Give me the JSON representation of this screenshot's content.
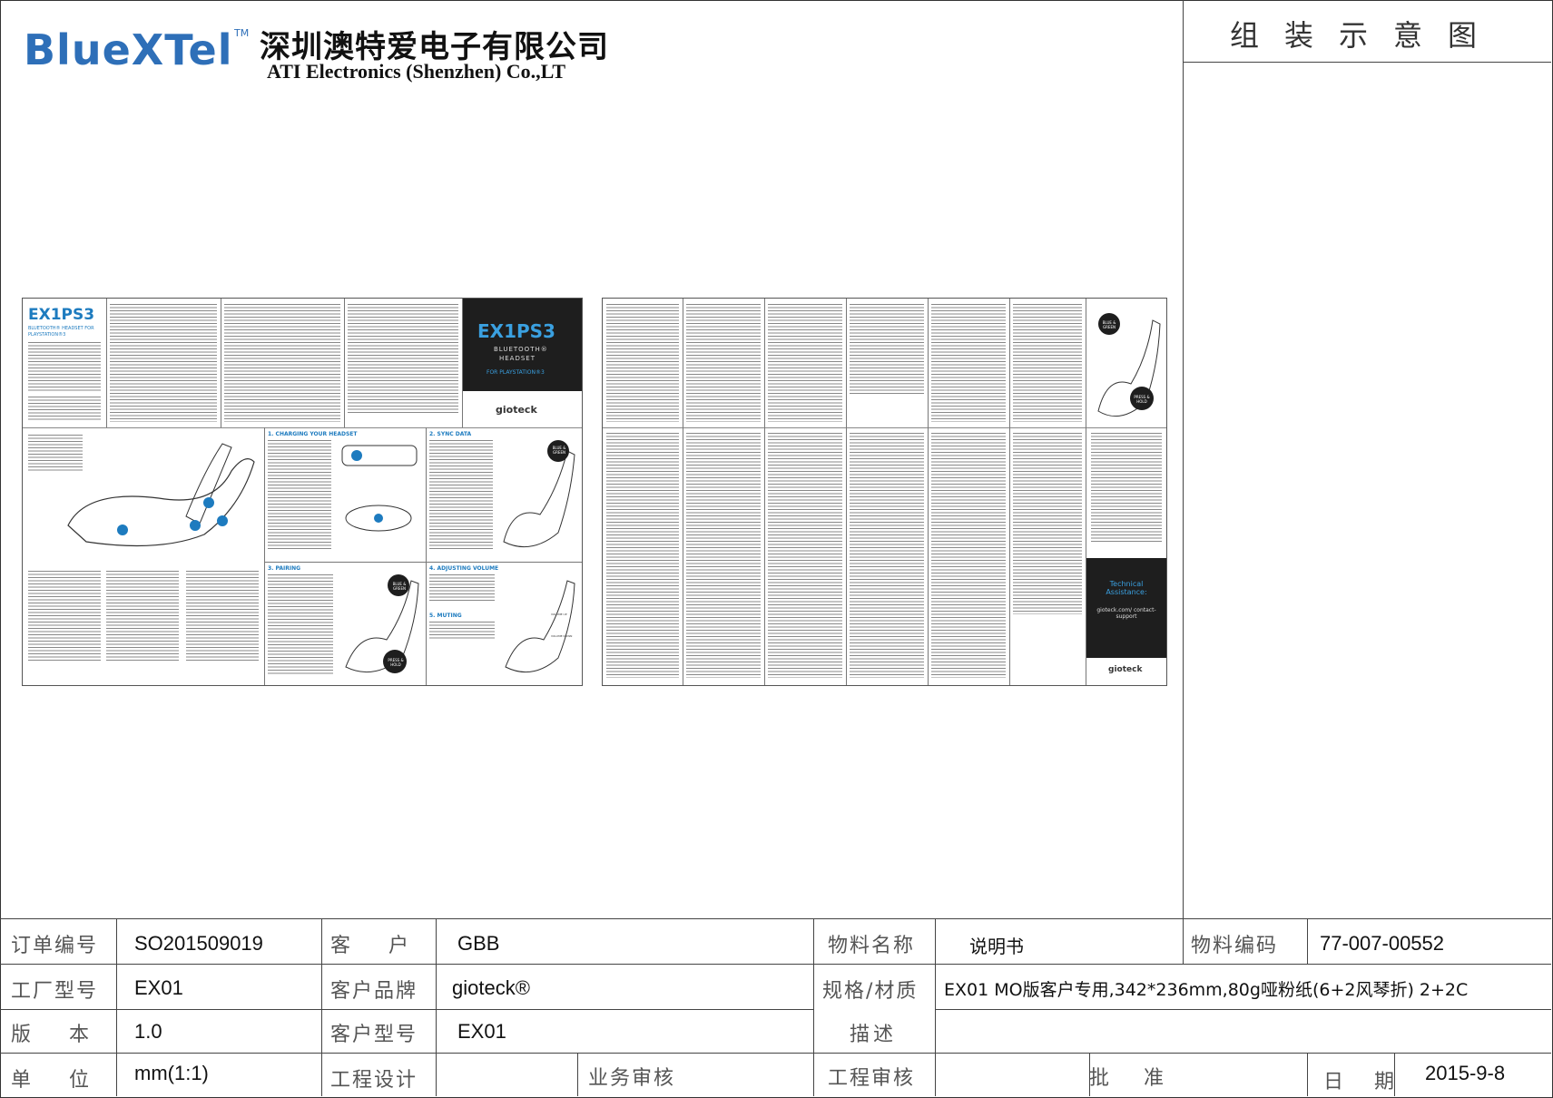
{
  "header": {
    "logo": "BlueXTel",
    "logo_tm": "TM",
    "company_cn": "深圳澳特爱电子有限公司",
    "company_en": "ATI Electronics (Shenzhen) Co.,LT",
    "drawing_title": "组装示意图"
  },
  "leaflet_left": {
    "model": "EX1PS3",
    "subtitle": "BLUETOOTH® HEADSET FOR PLAYSTATION®3",
    "cover_model": "EX1PS3",
    "cover_sub1": "BLUETOOTH®",
    "cover_sub2": "HEADSET",
    "cover_sub3": "FOR PLAYSTATION®3",
    "cover_brand": "gioteck",
    "sec1": "1. CHARGING YOUR HEADSET",
    "sec2": "2. SYNC DATA",
    "sec3": "3. PAIRING",
    "sec4": "4. ADJUSTING VOLUME",
    "sec5": "5. MUTING",
    "blue_green": "BLUE & GREEN",
    "press_hold": "PRESS & HOLD",
    "volume_up": "VOLUME UP",
    "volume_down": "VOLUME DOWN"
  },
  "leaflet_right": {
    "tech_title": "Technical Assistance:",
    "tech_url": "gioteck.com/ contact-support",
    "brand": "gioteck",
    "blue_green": "BLUE & GREEN",
    "press_hold": "PRESS & HOLD"
  },
  "table": {
    "order_no_label": "订单编号",
    "order_no": "SO201509019",
    "customer_label": "客　户",
    "customer": "GBB",
    "material_name_label": "物料名称",
    "material_name": "说明书",
    "material_code_label": "物料编码",
    "material_code": "77-007-00552",
    "factory_model_label": "工厂型号",
    "factory_model": "EX01",
    "customer_brand_label": "客户品牌",
    "customer_brand": "gioteck®",
    "spec_label_1": "规格/材质",
    "spec_label_2": "描述",
    "spec": "EX01 MO版客户专用,342*236mm,80g哑粉纸(6+2风琴折) 2+2C",
    "version_label": "版　本",
    "version": "1.0",
    "customer_model_label": "客户型号",
    "customer_model": "EX01",
    "unit_label": "单　位",
    "unit": "mm(1:1)",
    "eng_design_label": "工程设计",
    "biz_review_label": "业务审核",
    "eng_review_label": "工程审核",
    "approve_label": "批　准",
    "date_label": "日　期",
    "date": "2015-9-8"
  }
}
